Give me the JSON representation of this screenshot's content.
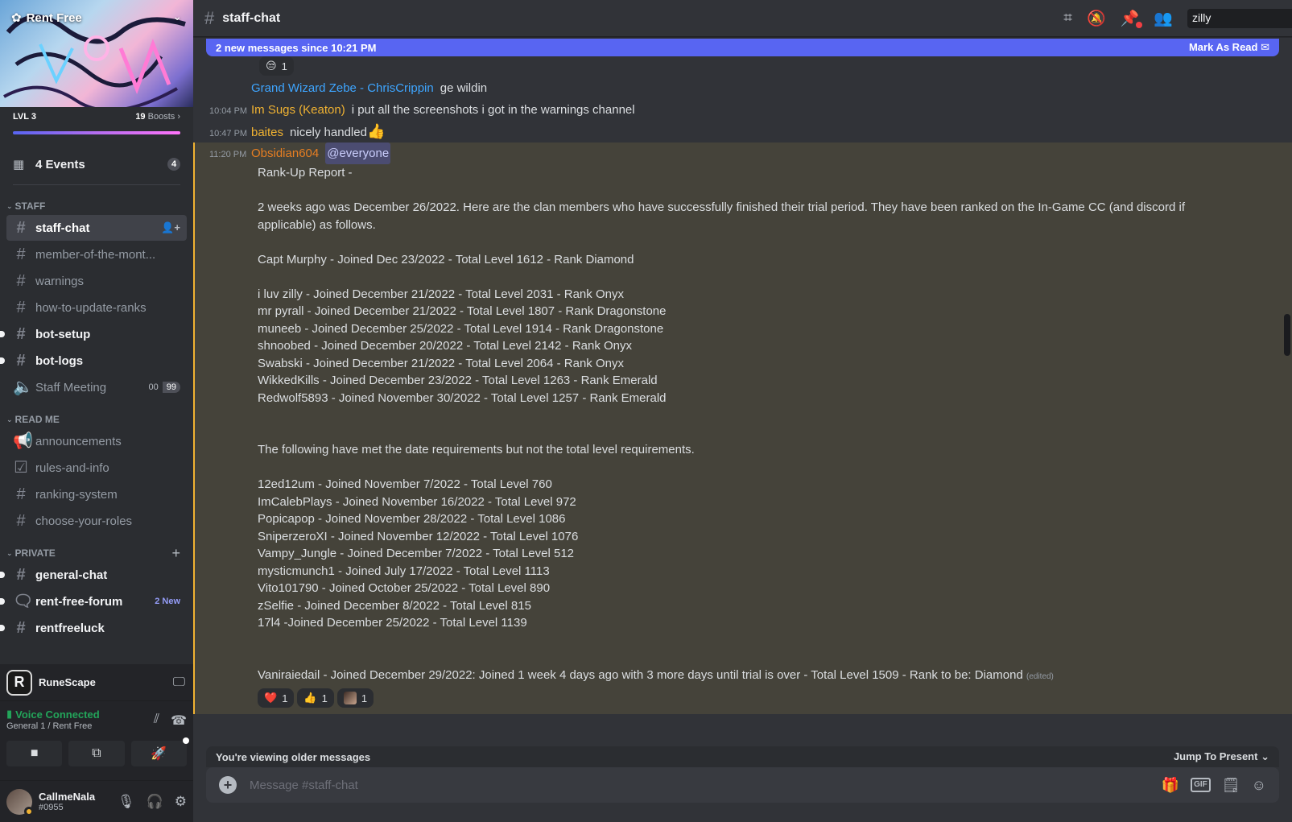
{
  "server": {
    "name": "Rent Free",
    "level": "LVL 3",
    "boosts_count": "19",
    "boosts_label": "Boosts"
  },
  "events": {
    "label": "4 Events",
    "count": "4"
  },
  "categories": {
    "staff": "STAFF",
    "readme": "READ ME",
    "private": "PRIVATE"
  },
  "channels": {
    "staff": [
      {
        "name": "staff-chat"
      },
      {
        "name": "member-of-the-mont..."
      },
      {
        "name": "warnings"
      },
      {
        "name": "how-to-update-ranks"
      },
      {
        "name": "bot-setup"
      },
      {
        "name": "bot-logs"
      },
      {
        "name": "Staff Meeting"
      }
    ],
    "readme": [
      {
        "name": "announcements"
      },
      {
        "name": "rules-and-info"
      },
      {
        "name": "ranking-system"
      },
      {
        "name": "choose-your-roles"
      }
    ],
    "private": [
      {
        "name": "general-chat"
      },
      {
        "name": "rent-free-forum",
        "badge": "2 New"
      },
      {
        "name": "rentfreeluck"
      }
    ]
  },
  "voice_counts": [
    "00",
    "99"
  ],
  "activity": {
    "name": "RuneScape"
  },
  "voice": {
    "status": "Voice Connected",
    "location": "General 1 / Rent Free"
  },
  "user": {
    "name": "CallmeNala",
    "tag": "#0955"
  },
  "header": {
    "channel": "staff-chat",
    "search_value": "zilly"
  },
  "new_bar": {
    "text": "2 new messages since 10:21 PM",
    "action": "Mark As Read"
  },
  "messages": {
    "top_reaction_count": "1",
    "m1": {
      "author": "Grand Wizard Zebe - ChrisCrippin",
      "text": "ge wildin"
    },
    "m2": {
      "time": "10:04 PM",
      "author": "Im Sugs (Keaton)",
      "text": "i put all the screenshots i got in the warnings channel"
    },
    "m3": {
      "time": "10:47 PM",
      "author": "baites",
      "text": "nicely handled"
    },
    "m4": {
      "time": "11:20 PM",
      "author": "Obsidian604",
      "mention": "@everyone"
    }
  },
  "report": {
    "lines": [
      "Rank-Up Report -",
      "",
      "2 weeks ago was December 26/2022. Here are the clan members who have successfully finished their trial period.  They have been ranked on the In-Game CC (and discord if applicable) as follows.",
      "",
      "Capt Murphy - Joined Dec 23/2022 - Total Level 1612 - Rank Diamond",
      "",
      "i luv zilly - Joined December 21/2022 - Total Level 2031 - Rank Onyx",
      "mr pyrall - Joined December 21/2022 - Total Level 1807 - Rank Dragonstone",
      "muneeb - Joined December 25/2022 - Total Level 1914 - Rank Dragonstone",
      "shnoobed - Joined December 20/2022 - Total Level 2142 - Rank Onyx",
      "Swabski - Joined December 21/2022 - Total Level 2064 - Rank Onyx",
      "WikkedKills - Joined December 23/2022  - Total Level 1263 - Rank Emerald",
      "Redwolf5893 - Joined November 30/2022 - Total Level 1257 - Rank Emerald",
      "",
      "",
      "The following have met the date requirements but not the total level requirements.",
      "",
      "12ed12um - Joined November 7/2022 - Total Level 760",
      "ImCalebPlays - Joined November 16/2022 - Total Level 972",
      "Popicapop - Joined November 28/2022 - Total Level 1086",
      "SniperzeroXI - Joined November 12/2022 - Total Level 1076",
      "Vampy_Jungle - Joined December 7/2022 - Total Level 512",
      "mysticmunch1 - Joined July 17/2022 - Total Level 1113",
      "Vito101790 - Joined October 25/2022 - Total Level 890",
      "zSelfie - Joined December 8/2022 - Total Level 815",
      "17l4 -Joined December 25/2022 - Total Level 1139",
      "",
      ""
    ],
    "last_line": "Vaniraiedail - Joined December 29/2022: Joined 1 week 4 days ago with 3 more days until trial is over - Total Level 1509 - Rank to be: Diamond",
    "edited": "(edited)",
    "reactions": [
      {
        "emoji": "heart",
        "count": "1"
      },
      {
        "emoji": "thumbs-up",
        "count": "1"
      },
      {
        "emoji": "custom-avatar",
        "count": "1"
      }
    ]
  },
  "older_bar": {
    "text": "You're viewing older messages",
    "action": "Jump To Present"
  },
  "composer": {
    "placeholder": "Message #staff-chat"
  },
  "colors": {
    "accent": "#5865f2",
    "voice_green": "#23a55a",
    "author_blue": "#3ea5ff",
    "author_gold": "#f0b232",
    "author_orange": "#e67e22",
    "highlight_bg": "#45433a"
  }
}
